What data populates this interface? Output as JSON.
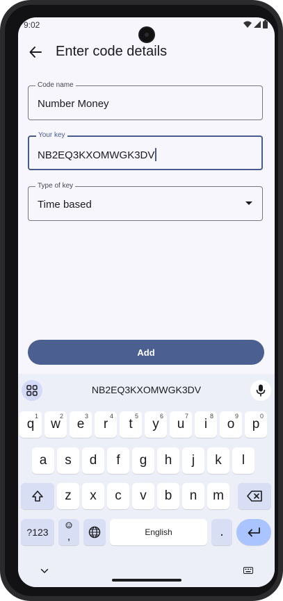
{
  "status": {
    "time": "9:02"
  },
  "appbar": {
    "title": "Enter code details"
  },
  "fields": {
    "code_name": {
      "label": "Code name",
      "value": "Number Money"
    },
    "your_key": {
      "label": "Your key",
      "value": "NB2EQ3KXOMWGK3DV"
    },
    "type_of_key": {
      "label": "Type of key",
      "value": "Time based"
    }
  },
  "add_button": {
    "label": "Add"
  },
  "keyboard": {
    "suggestion": "NB2EQ3KXOMWGK3DV",
    "row1": [
      {
        "key": "q",
        "hint": "1"
      },
      {
        "key": "w",
        "hint": "2"
      },
      {
        "key": "e",
        "hint": "3"
      },
      {
        "key": "r",
        "hint": "4"
      },
      {
        "key": "t",
        "hint": "5"
      },
      {
        "key": "y",
        "hint": "6"
      },
      {
        "key": "u",
        "hint": "7"
      },
      {
        "key": "i",
        "hint": "8"
      },
      {
        "key": "o",
        "hint": "9"
      },
      {
        "key": "p",
        "hint": "0"
      }
    ],
    "row2": [
      "a",
      "s",
      "d",
      "f",
      "g",
      "h",
      "j",
      "k",
      "l"
    ],
    "row3": [
      "z",
      "x",
      "c",
      "v",
      "b",
      "n",
      "m"
    ],
    "symbols_label": "?123",
    "comma_label": ",",
    "space_label": "English",
    "period_label": ".",
    "colors": {
      "accent": "#4c5f91",
      "enter": "#a9c4ff",
      "modifier": "#d8def3",
      "background": "#edeff8"
    }
  }
}
